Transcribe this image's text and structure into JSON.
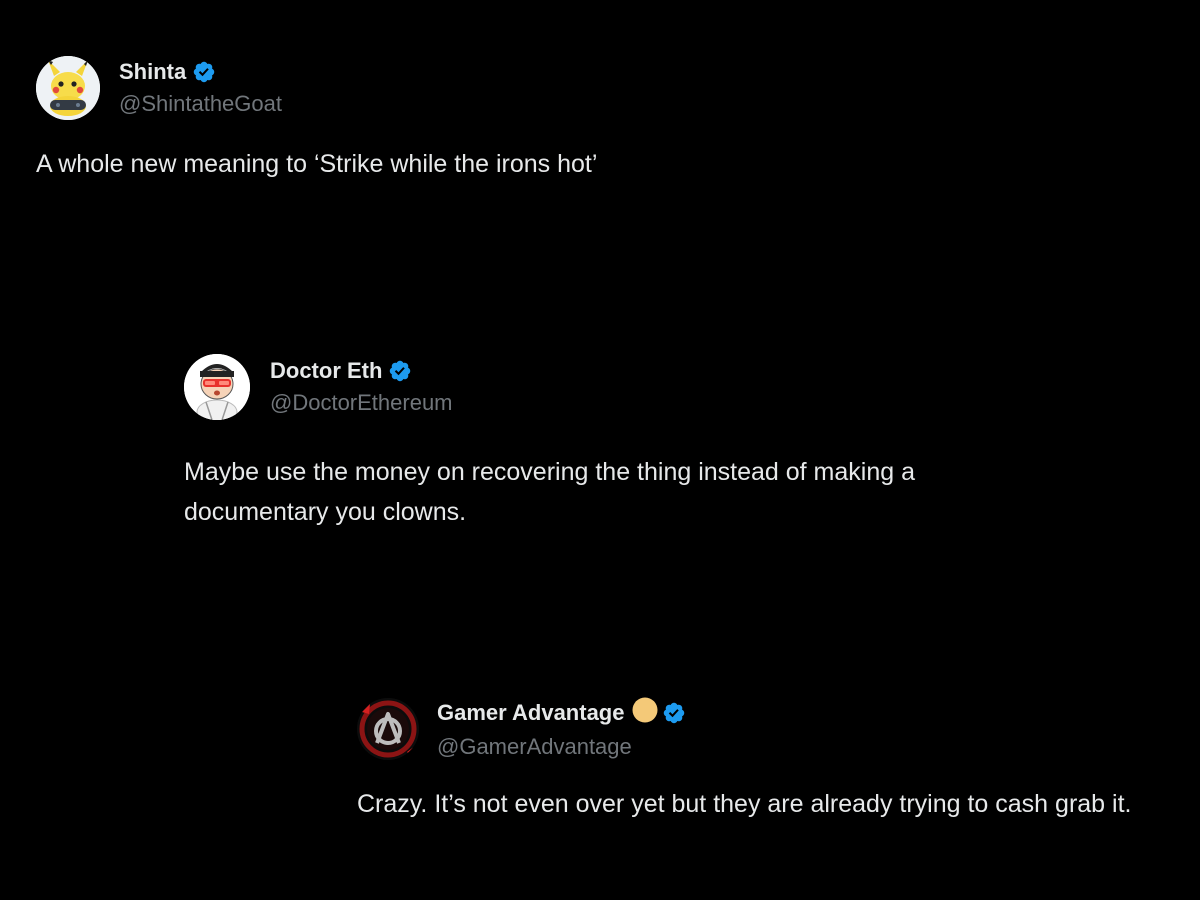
{
  "colors": {
    "background": "#000000",
    "text_primary": "#e7e9ea",
    "text_secondary": "#71767b",
    "verified_badge": "#1d9bf0",
    "affiliate_badge": "#f4c978"
  },
  "tweets": [
    {
      "display_name": "Shinta",
      "handle": "@ShintatheGoat",
      "verified": true,
      "avatar_icon": "pikachu-gamer-avatar",
      "text": "A whole new meaning to ‘Strike while the irons hot’"
    },
    {
      "display_name": "Doctor Eth",
      "handle": "@DoctorEthereum",
      "verified": true,
      "avatar_icon": "cartoon-doctor-avatar",
      "text": "Maybe use the money on recovering the thing instead of making a documentary you clowns."
    },
    {
      "display_name": "Gamer Advantage",
      "handle": "@GamerAdvantage",
      "verified": true,
      "has_affiliate_badge": true,
      "avatar_icon": "gamer-advantage-logo",
      "text": "Crazy. It’s not even over yet but they are already trying to cash grab it."
    }
  ]
}
